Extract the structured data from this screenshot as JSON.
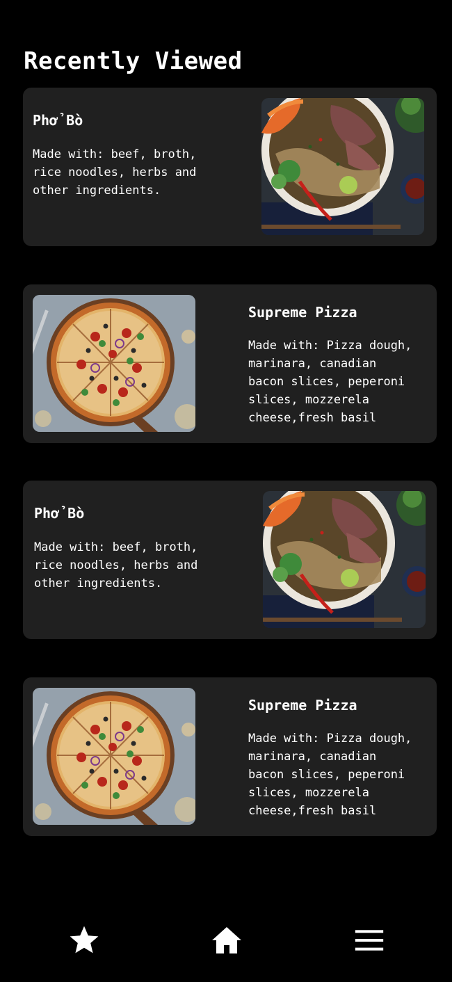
{
  "header": {
    "title": "Recently Viewed"
  },
  "recently_viewed": [
    {
      "title": "Phở Bò",
      "description": "Made with: beef, broth,\nrice noodles, herbs and\nother ingredients.",
      "image": "pho-bowl-photo"
    },
    {
      "title": "Supreme Pizza",
      "description": "Made with: Pizza dough,\nmarinara, canadian\nbacon slices, peperoni\nslices, mozzerela\ncheese,fresh basil",
      "image": "supreme-pizza-photo"
    },
    {
      "title": "Phở Bò",
      "description": "Made with: beef, broth,\nrice noodles, herbs and\nother ingredients.",
      "image": "pho-bowl-photo"
    },
    {
      "title": "Supreme Pizza",
      "description": "Made with: Pizza dough,\nmarinara, canadian\nbacon slices, peperoni\nslices, mozzerela\ncheese,fresh basil",
      "image": "supreme-pizza-photo"
    }
  ],
  "bottom_nav": {
    "items": [
      {
        "icon": "star-icon"
      },
      {
        "icon": "home-icon"
      },
      {
        "icon": "hamburger-menu-icon"
      }
    ]
  },
  "colors": {
    "background": "#000000",
    "card_background": "#202020",
    "text": "#ffffff"
  }
}
